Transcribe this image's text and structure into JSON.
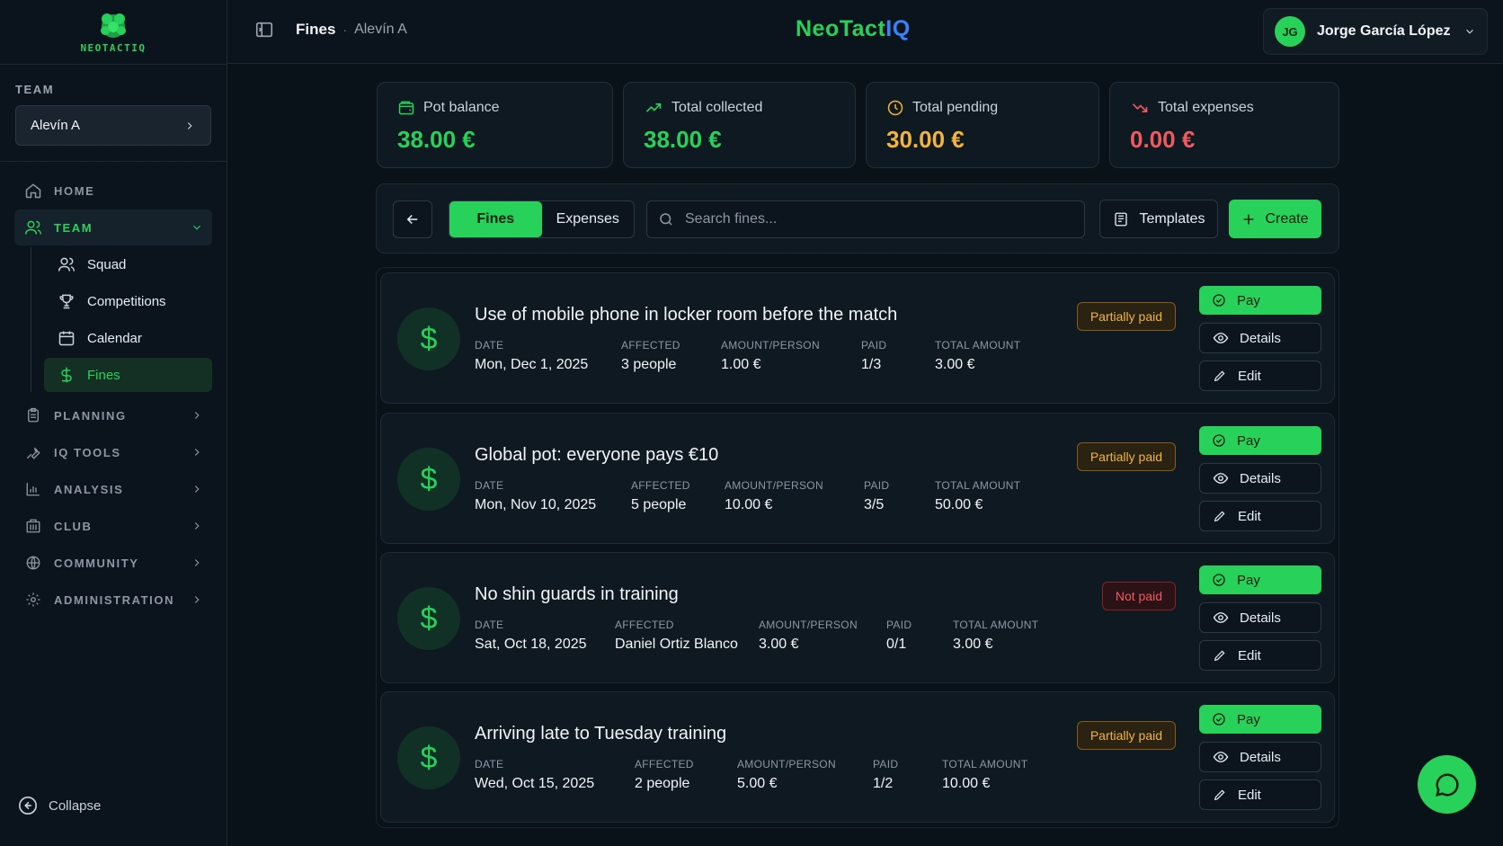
{
  "brand": {
    "logo_text": "NEOTACTIQ",
    "name_part1": "NeoTact",
    "name_part2": "IQ"
  },
  "sidebar": {
    "team_label": "TEAM",
    "team_selected": "Alevín A",
    "nav": [
      {
        "label": "HOME",
        "icon": "home-icon"
      },
      {
        "label": "TEAM",
        "icon": "users-icon",
        "expanded": true
      },
      {
        "label": "PLANNING",
        "icon": "clipboard-icon"
      },
      {
        "label": "IQ TOOLS",
        "icon": "wrench-icon"
      },
      {
        "label": "ANALYSIS",
        "icon": "bar-chart-icon"
      },
      {
        "label": "CLUB",
        "icon": "building-icon"
      },
      {
        "label": "COMMUNITY",
        "icon": "globe-icon"
      },
      {
        "label": "ADMINISTRATION",
        "icon": "gear-icon"
      }
    ],
    "team_sub": [
      {
        "label": "Squad",
        "icon": "users-icon"
      },
      {
        "label": "Competitions",
        "icon": "trophy-icon"
      },
      {
        "label": "Calendar",
        "icon": "calendar-icon"
      },
      {
        "label": "Fines",
        "icon": "dollar-icon",
        "active": true
      }
    ],
    "collapse_label": "Collapse"
  },
  "header": {
    "title": "Fines",
    "separator": "·",
    "subtitle": "Alevín A",
    "user": {
      "initials": "JG",
      "name": "Jorge García López"
    }
  },
  "stats": [
    {
      "label": "Pot balance",
      "value": "38.00 €",
      "color": "#27d15a",
      "icon": "wallet-icon"
    },
    {
      "label": "Total collected",
      "value": "38.00 €",
      "color": "#27d15a",
      "icon": "trending-up-icon"
    },
    {
      "label": "Total pending",
      "value": "30.00 €",
      "color": "#f2b53a",
      "icon": "clock-icon"
    },
    {
      "label": "Total expenses",
      "value": "0.00 €",
      "color": "#f05a5f",
      "icon": "trending-down-icon"
    }
  ],
  "toolbar": {
    "tabs": [
      "Fines",
      "Expenses"
    ],
    "search_placeholder": "Search fines...",
    "templates_label": "Templates",
    "create_label": "Create"
  },
  "labels": {
    "date": "DATE",
    "affected": "AFFECTED",
    "amount_person": "AMOUNT/PERSON",
    "paid": "PAID",
    "total_amount": "TOTAL AMOUNT",
    "pay": "Pay",
    "details": "Details",
    "edit": "Edit"
  },
  "fines": [
    {
      "title": "Use of mobile phone in locker room before the match",
      "date": "Mon, Dec 1, 2025",
      "affected": "3 people",
      "amount_person": "1.00 €",
      "paid": "1/3",
      "total": "3.00 €",
      "status": "Partially paid"
    },
    {
      "title": "Global pot: everyone pays €10",
      "date": "Mon, Nov 10, 2025",
      "affected": "5 people",
      "amount_person": "10.00 €",
      "paid": "3/5",
      "total": "50.00 €",
      "status": "Partially paid"
    },
    {
      "title": "No shin guards in training",
      "date": "Sat, Oct 18, 2025",
      "affected": "Daniel Ortiz Blanco",
      "amount_person": "3.00 €",
      "paid": "0/1",
      "total": "3.00 €",
      "status": "Not paid"
    },
    {
      "title": "Arriving late to Tuesday training",
      "date": "Wed, Oct 15, 2025",
      "affected": "2 people",
      "amount_person": "5.00 €",
      "paid": "1/2",
      "total": "10.00 €",
      "status": "Partially paid"
    }
  ],
  "colors": {
    "accent": "#27d15a",
    "warning": "#f2b53a",
    "danger": "#f05a5f",
    "info": "#3b82f6"
  }
}
